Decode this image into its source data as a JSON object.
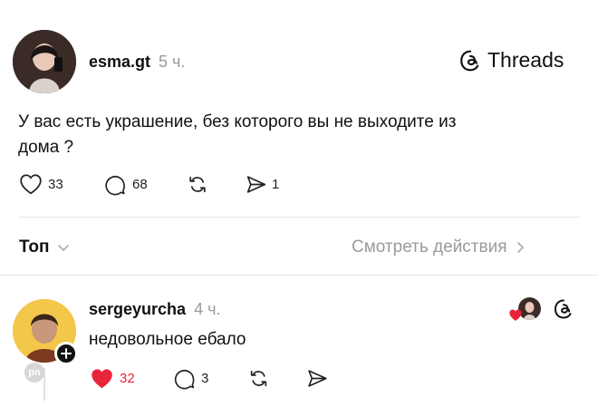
{
  "post": {
    "username": "esma.gt",
    "time": "5 ч.",
    "brand": "Threads",
    "text_line1": "У вас есть украшение, без которого вы не выходите из",
    "text_line2": "дома ?",
    "likes": "33",
    "replies": "68",
    "shares": "1"
  },
  "sort": {
    "label": "Топ",
    "activity_label": "Смотреть действия"
  },
  "reply": {
    "username": "sergeyurcha",
    "time": "4 ч.",
    "text": "недовольное ебало",
    "likes": "32",
    "replies": "3",
    "watermark": "pn"
  },
  "colors": {
    "accent_like": "#e8243b",
    "muted": "#9a9a9a",
    "divider": "#e6e6e6"
  }
}
